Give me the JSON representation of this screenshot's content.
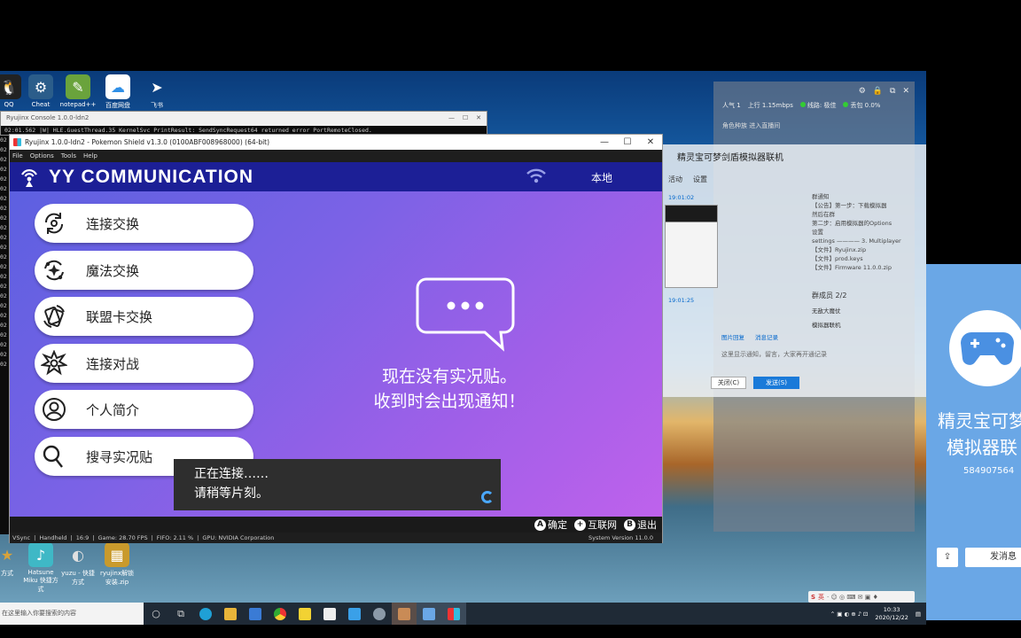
{
  "desktop": {
    "icons": [
      {
        "label": "QQ",
        "glyph": "🐧",
        "color": "#222222"
      },
      {
        "label": "Cheat",
        "glyph": "⚙",
        "color": "#2b5d8a"
      },
      {
        "label": "notepad++",
        "glyph": "✎",
        "color": "#6aa33c"
      },
      {
        "label": "百度网盘",
        "glyph": "☁",
        "color": "#2f8fe6"
      },
      {
        "label": "飞书",
        "glyph": "➤",
        "color": "#3aa0e8"
      }
    ],
    "bottom_icons": [
      {
        "label": "方式",
        "glyph": "★",
        "color": "#d8a23a"
      },
      {
        "label": "Hatsune Miku 快捷方式",
        "glyph": "♪",
        "color": "#3fb8c6"
      },
      {
        "label": "yuzu - 快捷方式",
        "glyph": "◐",
        "color": "#e0e0e0"
      },
      {
        "label": "ryujinx解锁安装.zip",
        "glyph": "▦",
        "color": "#c99a2c"
      }
    ]
  },
  "console": {
    "title": "Ryujinx Console 1.0.0-ldn2",
    "log_line": "02:01.562 |W| HLE.GuestThread.35 KernelSvc PrintResult: SendSyncRequest64 returned error PortRemoteClosed.",
    "strip": [
      "02",
      "02",
      "02",
      "02",
      "02",
      "02",
      "02",
      "02",
      "02",
      "02",
      "02",
      "02",
      "02",
      "02",
      "02",
      "02",
      "02",
      "02",
      "02",
      "02",
      "02",
      "02",
      "02",
      "02"
    ]
  },
  "emulator": {
    "window_title": "Ryujinx 1.0.0-ldn2 - Pokemon Shield v1.3.0 (0100ABF008968000) (64-bit)",
    "menu": [
      "File",
      "Options",
      "Tools",
      "Help"
    ],
    "app_title": "YY COMMUNICATION",
    "mode_label": "本地",
    "menu_buttons": [
      {
        "label": "连接交换",
        "icon": "link-trade-icon"
      },
      {
        "label": "魔法交换",
        "icon": "magic-trade-icon"
      },
      {
        "label": "联盟卡交换",
        "icon": "league-card-icon"
      },
      {
        "label": "连接对战",
        "icon": "battle-icon"
      },
      {
        "label": "个人简介",
        "icon": "profile-icon"
      },
      {
        "label": "搜寻实况贴",
        "icon": "search-icon"
      }
    ],
    "empty_message": [
      "现在没有实况贴。",
      "收到时会出现通知！"
    ],
    "toast": [
      "正在连接……",
      "请稍等片刻。"
    ],
    "footer": [
      {
        "key": "A",
        "label": "确定"
      },
      {
        "key": "+",
        "label": "互联网"
      },
      {
        "key": "B",
        "label": "退出"
      }
    ],
    "status": {
      "vsync": "VSync",
      "mode": "Handheld",
      "aspect": "16:9",
      "fps": "Game: 28.70 FPS",
      "fifo": "FIFO: 2.11 %",
      "gpu": "GPU:  NVIDIA Corporation",
      "system_version": "System Version    11.0.0"
    },
    "colors": {
      "header": "#1c1f96",
      "gradient_start": "#5a60e0",
      "gradient_end": "#c062ec"
    }
  },
  "yy_panel": {
    "popularity": "人气 1",
    "upload": "上行 1.15mbps",
    "line_quality": "线路: 极佳",
    "packet_loss": "丢包 0.0%",
    "sub": "角色种族  进入直播间"
  },
  "qq_window": {
    "title": "精灵宝可梦剑盾模拟器联机",
    "tabs": [
      "活动",
      "设置"
    ],
    "time1": "19:01:02",
    "time2": "19:01:25",
    "notice": [
      "群通知",
      "【公告】第一步：下载模拟器",
      "然后在群",
      "第二步：启用模拟器的Options",
      "设置",
      "settings ———— 3. Multiplayer",
      "【文件】Ryujinx.zip",
      "【文件】prod.keys",
      "【文件】Firmware 11.0.0.zip"
    ],
    "members_label": "群成员 2/2",
    "members": [
      "无敌大魔仗",
      "模拟器联机"
    ],
    "tool_tabs": [
      "图片回复",
      "消息记录"
    ],
    "input_hint": "这里显示通知，留言，大家再开通记录",
    "close_label": "关闭(C)",
    "send_label": "发送(S)"
  },
  "group_card": {
    "name_line1": "精灵宝可梦",
    "name_line2": "模拟器联",
    "group_id": "584907564",
    "send_label": "发消息"
  },
  "taskbar": {
    "search_placeholder": "在这里输入你要搜索的内容",
    "time": "10:33",
    "date": "2020/12/22",
    "ime": "英"
  }
}
